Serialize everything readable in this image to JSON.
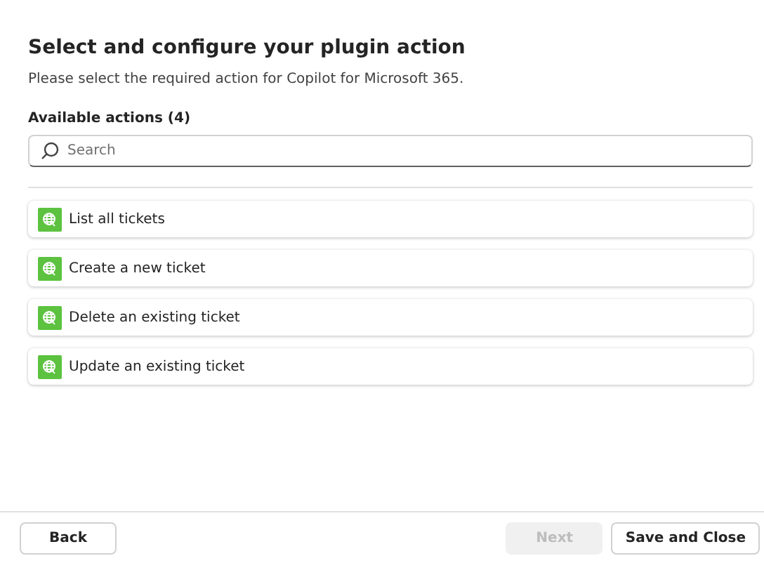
{
  "title": "Select and configure your plugin action",
  "subtitle": "Please select the required action for Copilot for Microsoft 365.",
  "actions_label": "Available actions (4)",
  "search": {
    "placeholder": "Search"
  },
  "actions": [
    {
      "label": "List all tickets"
    },
    {
      "label": "Create a new ticket"
    },
    {
      "label": "Delete an existing ticket"
    },
    {
      "label": "Update an existing ticket"
    }
  ],
  "footer": {
    "left_buttons": [
      {
        "label": "Back",
        "disabled": false
      }
    ],
    "right_buttons": [
      {
        "label": "Next",
        "disabled": true
      },
      {
        "label": "Save and Close",
        "disabled": false
      }
    ]
  }
}
